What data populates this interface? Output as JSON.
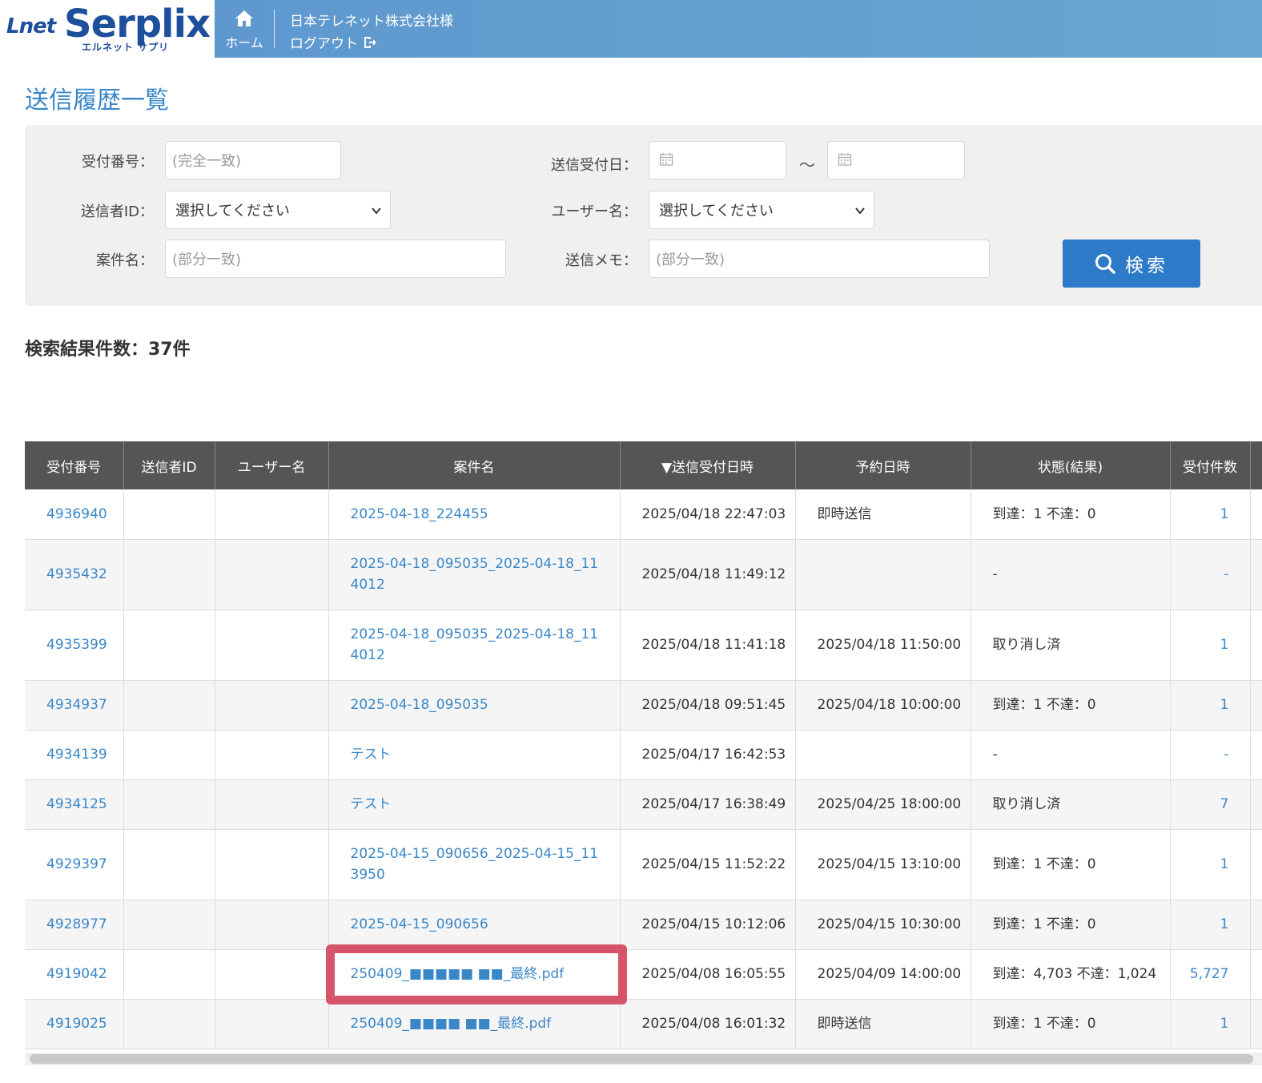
{
  "header": {
    "logo_main": "Serplix",
    "logo_prefix": "Lnet",
    "logo_sub": "エルネット サプリ",
    "home_label": "ホーム",
    "company": "日本テレネット株式会社様",
    "logout_label": "ログアウト"
  },
  "page_title": "送信履歴一覧",
  "search": {
    "receipt_no_label": "受付番号：",
    "receipt_no_placeholder": "(完全一致)",
    "date_label": "送信受付日：",
    "date_separator": "～",
    "sender_id_label": "送信者ID：",
    "sender_id_value": "選択してください",
    "user_name_label": "ユーザー名：",
    "user_name_value": "選択してください",
    "case_name_label": "案件名：",
    "case_name_placeholder": "(部分一致)",
    "memo_label": "送信メモ：",
    "memo_placeholder": "(部分一致)",
    "search_button": "検索"
  },
  "result_count": "検索結果件数：37件",
  "table": {
    "headers": [
      "受付番号",
      "送信者ID",
      "ユーザー名",
      "案件名",
      "▼送信受付日時",
      "予約日時",
      "状態(結果)",
      "受付件数"
    ],
    "rows": [
      {
        "no": "4936940",
        "sender": "",
        "user": "",
        "name": "2025-04-18_224455",
        "received": "2025/04/18 22:47:03",
        "reserved": "即時送信",
        "status": "到達：1 不達：0",
        "count": "1"
      },
      {
        "no": "4935432",
        "sender": "",
        "user": "",
        "name": "2025-04-18_095035_2025-04-18_114012",
        "received": "2025/04/18 11:49:12",
        "reserved": "",
        "status": "-",
        "count": "-"
      },
      {
        "no": "4935399",
        "sender": "",
        "user": "",
        "name": "2025-04-18_095035_2025-04-18_114012",
        "received": "2025/04/18 11:41:18",
        "reserved": "2025/04/18 11:50:00",
        "status": "取り消し済",
        "count": "1"
      },
      {
        "no": "4934937",
        "sender": "",
        "user": "",
        "name": "2025-04-18_095035",
        "received": "2025/04/18 09:51:45",
        "reserved": "2025/04/18 10:00:00",
        "status": "到達：1 不達：0",
        "count": "1"
      },
      {
        "no": "4934139",
        "sender": "",
        "user": "",
        "name": "テスト",
        "received": "2025/04/17 16:42:53",
        "reserved": "",
        "status": "-",
        "count": "-"
      },
      {
        "no": "4934125",
        "sender": "",
        "user": "",
        "name": "テスト",
        "received": "2025/04/17 16:38:49",
        "reserved": "2025/04/25 18:00:00",
        "status": "取り消し済",
        "count": "7"
      },
      {
        "no": "4929397",
        "sender": "",
        "user": "",
        "name": "2025-04-15_090656_2025-04-15_113950",
        "received": "2025/04/15 11:52:22",
        "reserved": "2025/04/15 13:10:00",
        "status": "到達：1 不達：0",
        "count": "1"
      },
      {
        "no": "4928977",
        "sender": "",
        "user": "",
        "name": "2025-04-15_090656",
        "received": "2025/04/15 10:12:06",
        "reserved": "2025/04/15 10:30:00",
        "status": "到達：1 不達：0",
        "count": "1"
      },
      {
        "no": "4919042",
        "sender": "",
        "user": "",
        "name": "250409_■■■■■ ■■_最終.pdf",
        "received": "2025/04/08 16:05:55",
        "reserved": "2025/04/09 14:00:00",
        "status": "到達：4,703 不達：1,024",
        "count": "5,727"
      },
      {
        "no": "4919025",
        "sender": "",
        "user": "",
        "name": "250409_■■■■ ■■_最終.pdf",
        "received": "2025/04/08 16:01:32",
        "reserved": "即時送信",
        "status": "到達：1 不達：0",
        "count": "1"
      }
    ]
  },
  "colors": {
    "header_bg": "#5b95cf",
    "title": "#3a87c8",
    "link": "#3a87c8",
    "table_header": "#555555",
    "button": "#2d7ac9",
    "highlight": "#d6546a"
  }
}
